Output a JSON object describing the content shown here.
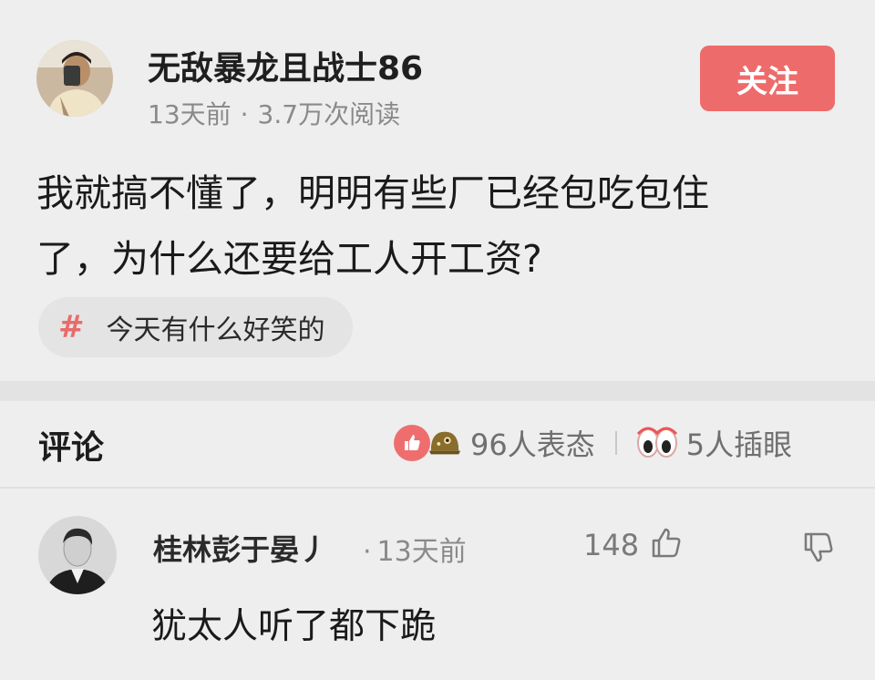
{
  "post": {
    "author_name": "无敌暴龙且战士86",
    "time": "13天前",
    "separator": "·",
    "views": "3.7万次阅读",
    "follow_label": "关注",
    "body_line1": "我就搞不懂了，明明有些厂已经包吃包住",
    "body_line2": "了，为什么还要给工人开工资?",
    "topic_hash": "#",
    "topic": "今天有什么好笑的"
  },
  "comments_bar": {
    "title": "评论",
    "reactions_label": "96人表态",
    "eyes_label": "5人插眼"
  },
  "comment": {
    "author_name": "桂林彭于晏丿",
    "separator": "·",
    "time": "13天前",
    "likes": "148",
    "text": "犹太人听了都下跪"
  },
  "colors": {
    "accent": "#ee6b6b",
    "hash": "#e86b6b",
    "muted_text": "#8a8a8a",
    "background": "#eeeeee"
  },
  "icons": {
    "like_reaction": "thumbs-up-icon",
    "helmet_reaction": "helmet-emoji-icon",
    "eyes_reaction": "eyes-emoji-icon",
    "comment_like": "thumbs-up-outline-icon",
    "comment_dislike": "thumbs-down-outline-icon"
  }
}
